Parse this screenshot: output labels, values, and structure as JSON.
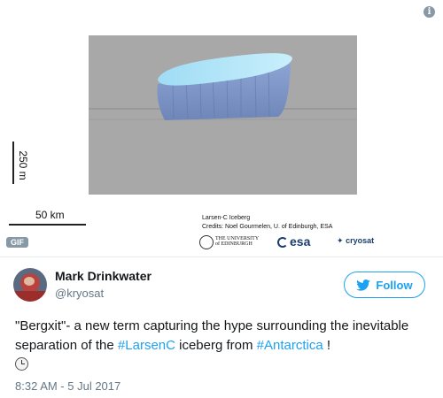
{
  "media": {
    "info_icon": "info-icon",
    "vertical_scale_label": "250 m",
    "horizontal_scale_label": "50 km",
    "caption_line1": "Larsen-C Iceberg",
    "caption_line2": "Credits: Noel Gourmelen, U. of Edinburgh, ESA",
    "logo_edinburgh_line1": "THE UNIVERSITY",
    "logo_edinburgh_line2": "of EDINBURGH",
    "logo_esa": "esa",
    "logo_cryosat": "cryosat",
    "gif_badge": "GIF",
    "colors": {
      "plot_background": "#a8a8a8",
      "iceberg_top": "#aee3f7",
      "iceberg_side": "#7f97c4"
    }
  },
  "author": {
    "name": "Mark Drinkwater",
    "handle": "@kryosat"
  },
  "follow_button": {
    "label": "Follow",
    "icon": "twitter-bird-icon"
  },
  "tweet": {
    "text_before": "\"Bergxit\"- a new term capturing the hype surrounding the inevitable separation of the ",
    "hashtag1": "#LarsenC",
    "text_middle": " iceberg from ",
    "hashtag2": "#Antarctica",
    "text_after": " !",
    "emoji": "clock-icon"
  },
  "timestamp": "8:32 AM - 5 Jul 2017",
  "colors": {
    "accent": "#1da1f2",
    "secondary_text": "#657786"
  }
}
